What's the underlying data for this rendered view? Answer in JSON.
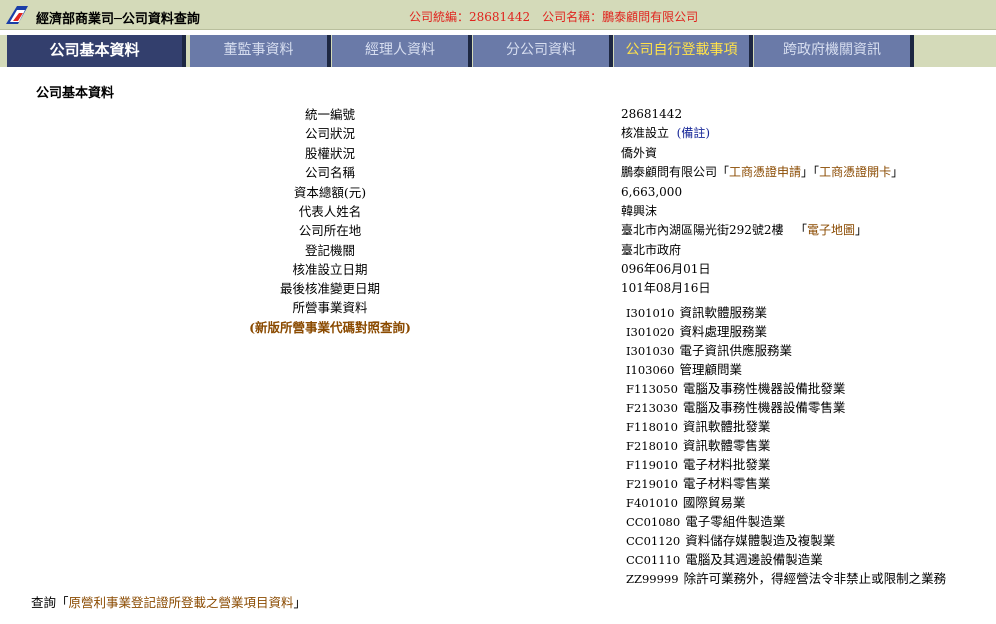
{
  "header": {
    "title": "經濟部商業司─公司資料查詢",
    "company_no_label": "公司統編：",
    "company_no": "28681442",
    "company_name_label": "公司名稱：",
    "company_name": "鵬泰顧問有限公司"
  },
  "tabs": [
    {
      "label": "公司基本資料"
    },
    {
      "label": "董監事資料"
    },
    {
      "label": "經理人資料"
    },
    {
      "label": "分公司資料"
    },
    {
      "label": "公司自行登載事項"
    },
    {
      "label": "跨政府機關資訊"
    }
  ],
  "section_title": "公司基本資料",
  "fields": {
    "tax_id": {
      "label": "統一編號",
      "value": "28681442"
    },
    "status": {
      "label": "公司狀況",
      "value": "核准設立",
      "note": "(備註)"
    },
    "equity": {
      "label": "股權狀況",
      "value": "僑外資"
    },
    "name": {
      "label": "公司名稱",
      "value": "鵬泰顧問有限公司",
      "link1": "工商憑證申請",
      "link2": "工商憑證開卡"
    },
    "capital": {
      "label": "資本總額(元)",
      "value": "6,663,000"
    },
    "representative": {
      "label": "代表人姓名",
      "value": "韓興沫"
    },
    "address": {
      "label": "公司所在地",
      "value": "臺北市內湖區陽光街292號2樓",
      "map_link": "電子地圖"
    },
    "authority": {
      "label": "登記機關",
      "value": "臺北市政府"
    },
    "approved_date": {
      "label": "核准設立日期",
      "value": "096年06月01日"
    },
    "changed_date": {
      "label": "最後核准變更日期",
      "value": "101年08月16日"
    },
    "business": {
      "label": "所營事業資料",
      "lookup_link": "(新版所營事業代碼對照查詢)"
    }
  },
  "business_items": [
    {
      "code": "I301010",
      "desc": "資訊軟體服務業"
    },
    {
      "code": "I301020",
      "desc": "資料處理服務業"
    },
    {
      "code": "I301030",
      "desc": "電子資訊供應服務業"
    },
    {
      "code": "I103060",
      "desc": "管理顧問業"
    },
    {
      "code": "F113050",
      "desc": "電腦及事務性機器設備批發業"
    },
    {
      "code": "F213030",
      "desc": "電腦及事務性機器設備零售業"
    },
    {
      "code": "F118010",
      "desc": "資訊軟體批發業"
    },
    {
      "code": "F218010",
      "desc": "資訊軟體零售業"
    },
    {
      "code": "F119010",
      "desc": "電子材料批發業"
    },
    {
      "code": "F219010",
      "desc": "電子材料零售業"
    },
    {
      "code": "F401010",
      "desc": "國際貿易業"
    },
    {
      "code": "CC01080",
      "desc": "電子零組件製造業"
    },
    {
      "code": "CC01120",
      "desc": "資料儲存媒體製造及複製業"
    },
    {
      "code": "CC01110",
      "desc": "電腦及其週邊設備製造業"
    },
    {
      "code": "ZZ99999",
      "desc": "除許可業務外，得經營法令非禁止或限制之業務"
    }
  ],
  "footer": {
    "prefix": "查詢",
    "link": "原營利事業登記證所登載之營業項目資料"
  },
  "colors": {
    "header_bg": "#d4dab9",
    "tab_bg": "#6a7aa8",
    "tab_active_bg": "#333f6d",
    "summary_red": "#e0241e",
    "link_brown": "#8a4a00",
    "note_blue": "#1a2a99"
  }
}
